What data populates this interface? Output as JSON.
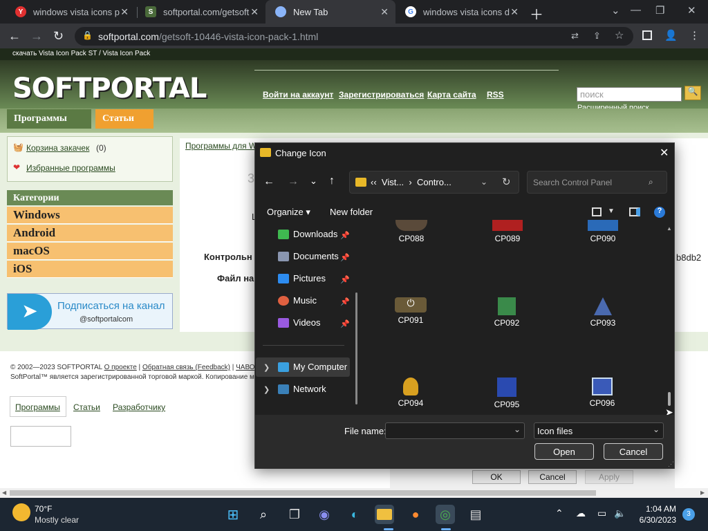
{
  "tabs": [
    {
      "title": "windows vista icons pa",
      "favicon": "Y"
    },
    {
      "title": "softportal.com/getsoft",
      "favicon": "S"
    },
    {
      "title": "New Tab",
      "favicon": ""
    },
    {
      "title": "windows vista icons do",
      "favicon": "G"
    }
  ],
  "browser": {
    "url_domain": "softportal.com",
    "url_path": "/getsoft-10446-vista-icon-pack-1.html"
  },
  "site": {
    "topstrip": "скачать Vista Icon Pack ST / Vista Icon Pack",
    "logo": "SOFTPORTAL",
    "header_links": [
      "Войти на аккаунт",
      "Зарегистрироваться",
      "Карта сайта",
      "RSS"
    ],
    "search_placeholder": "поиск",
    "advanced_search": "Расширенный поиск",
    "nav": [
      "Программы",
      "Статьи"
    ],
    "cart": "Корзина закачек",
    "cart_count": "(0)",
    "favorites": "Избранные программы",
    "categories_title": "Категории",
    "categories": [
      "Windows",
      "Android",
      "macOS",
      "iOS"
    ],
    "telegram_cta": "Подписаться на канал",
    "telegram_handle": "@softportalcom",
    "breadcrumb": "Программы для W",
    "content_digit": "3",
    "content_l": "L",
    "content_label1": "Контрольн",
    "content_label2": "Файл на",
    "content_hash": "b8db2",
    "footer_line1": "© 2002—2023 SOFTPORTAL",
    "footer_links": [
      "О проекте",
      "Обратная связь (Feedback)",
      "ЧАВО",
      "С"
    ],
    "footer_line2": "SoftPortal™ является зарегистрированной торговой маркой. Копирование м",
    "footer_tabs": [
      "Программы",
      "Статьи",
      "Разработчику"
    ]
  },
  "bg_dialog": {
    "ok": "OK",
    "cancel": "Cancel",
    "apply": "Apply"
  },
  "dialog": {
    "title": "Change Icon",
    "address": [
      "Vist...",
      "Contro..."
    ],
    "search_placeholder": "Search Control Panel",
    "organize": "Organize",
    "new_folder": "New folder",
    "tree": [
      {
        "label": "Downloads",
        "color": "#3fb950",
        "pinned": true
      },
      {
        "label": "Documents",
        "color": "#8a96b0",
        "pinned": true
      },
      {
        "label": "Pictures",
        "color": "#2d8cf0",
        "pinned": true
      },
      {
        "label": "Music",
        "color": "#e06040",
        "pinned": true
      },
      {
        "label": "Videos",
        "color": "#9a5ae0",
        "pinned": true
      }
    ],
    "my_computer": "My Computer",
    "network": "Network",
    "icons": [
      {
        "label": "CP088",
        "color": "#5a4a3a"
      },
      {
        "label": "CP089",
        "color": "#b02020"
      },
      {
        "label": "CP090",
        "color": "#2a6ab8"
      },
      {
        "label": "CP091",
        "color": "#6a5a38"
      },
      {
        "label": "CP092",
        "color": "#3a8a4a"
      },
      {
        "label": "CP093",
        "color": "#4a6ab0"
      },
      {
        "label": "CP094",
        "color": "#d8a020"
      },
      {
        "label": "CP095",
        "color": "#2a4ab0"
      },
      {
        "label": "CP096",
        "color": "#3a5ab8"
      }
    ],
    "file_name_label": "File name:",
    "file_name_value": "",
    "filter": "Icon files",
    "open": "Open",
    "cancel": "Cancel"
  },
  "taskbar": {
    "temp": "70°F",
    "weather": "Mostly clear",
    "time": "1:04 AM",
    "date": "6/30/2023",
    "notifications": "3"
  }
}
